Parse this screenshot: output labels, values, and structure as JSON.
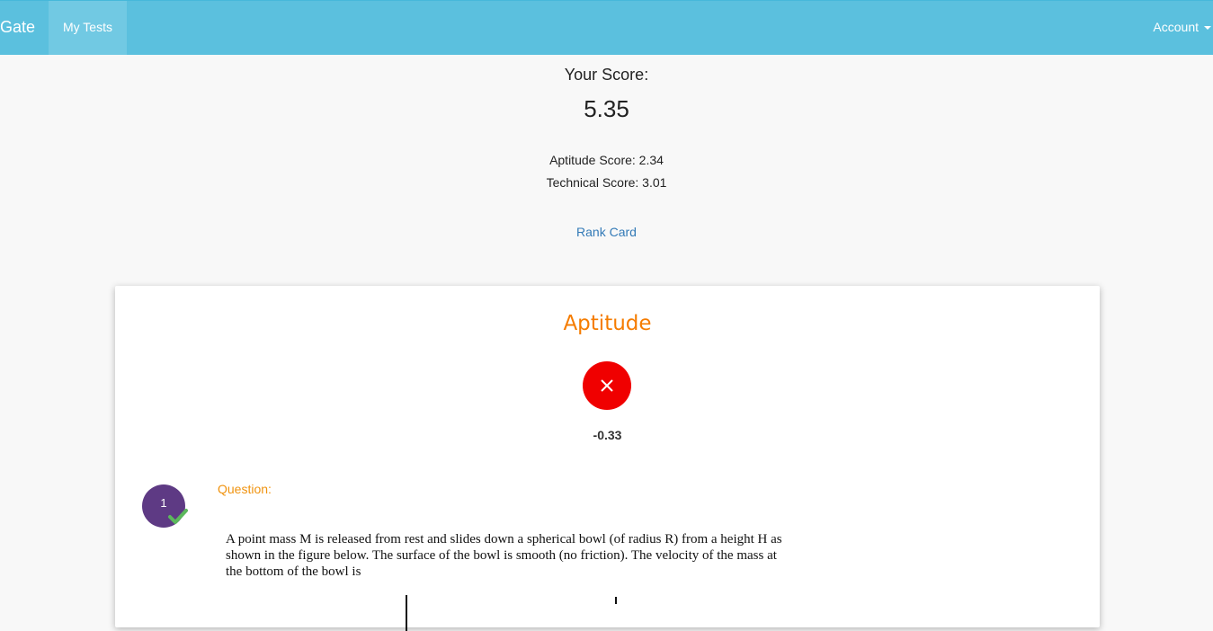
{
  "nav": {
    "brand": "Gate",
    "my_tests": "My Tests",
    "account": "Account"
  },
  "score": {
    "heading": "Your Score:",
    "total": "5.35",
    "aptitude_label": "Aptitude Score: 2.34",
    "technical_label": "Technical Score: 3.01",
    "rank_card": "Rank Card"
  },
  "section": {
    "title": "Aptitude",
    "marks": "-0.33",
    "status_icon": "close-icon",
    "status_color": "#f00000"
  },
  "question": {
    "number": "1",
    "label": "Question:",
    "text": "A point mass M is released from rest and slides down a spherical bowl (of radius R) from a height H as shown in the figure below. The surface of the bowl is smooth (no friction). The velocity of the mass at the bottom of the bowl is",
    "answered_icon": "check-icon"
  },
  "colors": {
    "navbar": "#5bc0de",
    "accent_orange": "#f57c00",
    "link": "#337ab7",
    "question_badge": "#5e3a84",
    "check_green": "#5cb85c"
  }
}
